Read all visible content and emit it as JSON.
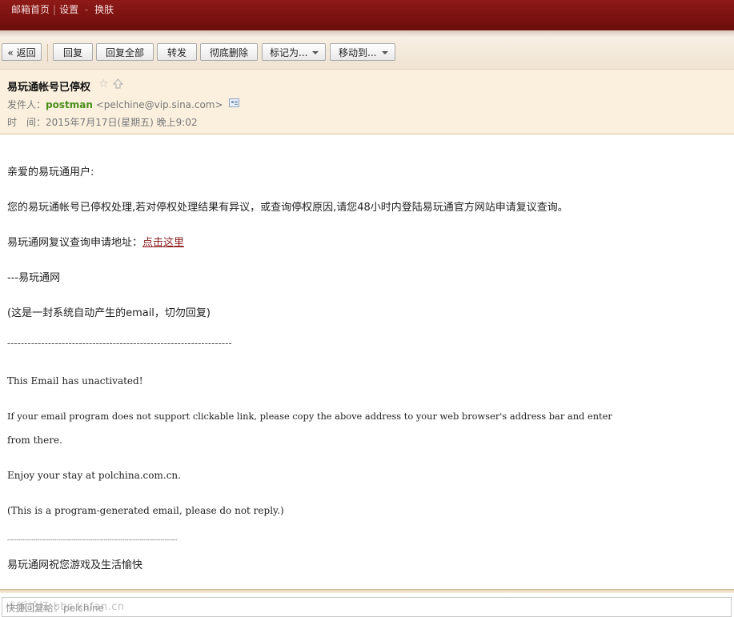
{
  "topnav": {
    "home": "邮箱首页",
    "settings": "设置",
    "dash": "-",
    "skin": "换肤"
  },
  "toolbar": {
    "back": "« 返回",
    "reply": "回复",
    "reply_all": "回复全部",
    "forward": "转发",
    "delete": "彻底删除",
    "mark_as": "标记为...",
    "move_to": "移动到..."
  },
  "header": {
    "subject": "易玩通帐号已停权",
    "from_label": "发件人：",
    "sender_name": "postman",
    "sender_email": "<pelchine@vip.sina.com>",
    "time_label": "时　间：",
    "time_value": "2015年7月17日(星期五) 晚上9:02"
  },
  "body": {
    "greeting": "亲爱的易玩通用户:",
    "para1": "您的易玩通帐号已停权处理,若对停权处理结果有异议，或查询停权原因,请您48小时内登陆易玩通官方网站申请复议查询。",
    "appeal_label": "易玩通网复议查询申请地址：",
    "appeal_link": "点击这里",
    "signature": "---易玩通网",
    "auto_note": "(这是一封系统自动产生的email，切勿回复)",
    "rule1": "------------------------------------------------------------------",
    "en_line1": "This Email has unactivated!",
    "en_line2a": "If your email program does not support clickable link, please copy the above address to your web browser's address bar and enter",
    "en_line2b": "from there.",
    "en_line3": "Enjoy your stay at polchina.com.cn.",
    "en_line4": "(This is a program-generated email, please do not reply.)",
    "rule2": "------------------------------------------------------------------------------------------",
    "closing": "易玩通网祝您游戏及生活愉快"
  },
  "footer": {
    "reply_placeholder": "快捷回复给：pelchine",
    "watermark": "卡饭论坛 bbs.kafan.cn"
  }
}
